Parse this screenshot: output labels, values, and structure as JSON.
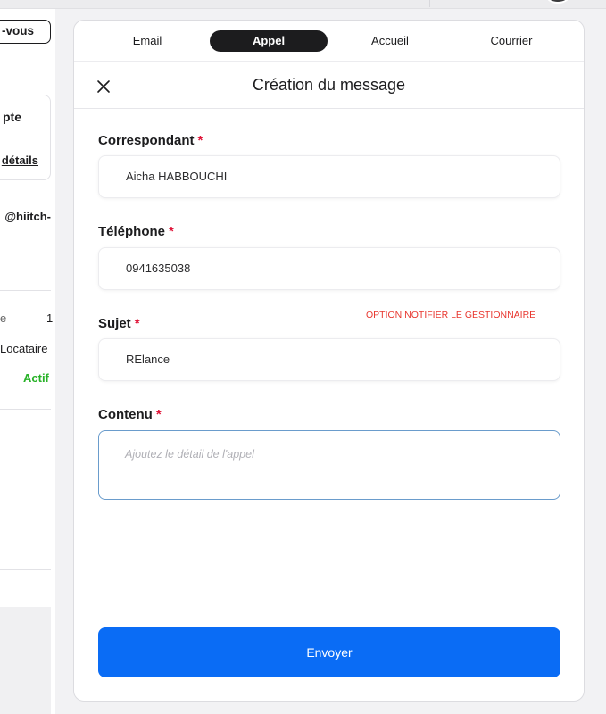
{
  "background": {
    "appointment_button": "-vous",
    "card_title": "pte",
    "card_link": "détails",
    "email_fragment": "@hiitch-",
    "row1_label": "e",
    "row1_value": "1",
    "row2_label": "Locataire",
    "row3_status": "Actif"
  },
  "tabs": [
    {
      "label": "Email",
      "active": false
    },
    {
      "label": "Appel",
      "active": true
    },
    {
      "label": "Accueil",
      "active": false
    },
    {
      "label": "Courrier",
      "active": false
    }
  ],
  "header": {
    "close_icon": "close-icon",
    "title": "Création du message"
  },
  "form": {
    "correspondent": {
      "label": "Correspondant",
      "required_mark": "*",
      "value": "Aicha HABBOUCHI"
    },
    "phone": {
      "label": "Téléphone",
      "required_mark": "*",
      "value": "0941635038"
    },
    "subject": {
      "label": "Sujet",
      "required_mark": "*",
      "value": "RElance"
    },
    "content": {
      "label": "Contenu",
      "required_mark": "*",
      "placeholder": "Ajoutez le détail de l'appel"
    },
    "notify_note": "OPTION NOTIFIER LE GESTIONNAIRE"
  },
  "submit_label": "Envoyer",
  "colors": {
    "accent": "#0a6cf5",
    "required": "#e0163a",
    "note": "#e8372f",
    "active_tab": "#1c1c1e",
    "status_active": "#28b228"
  }
}
